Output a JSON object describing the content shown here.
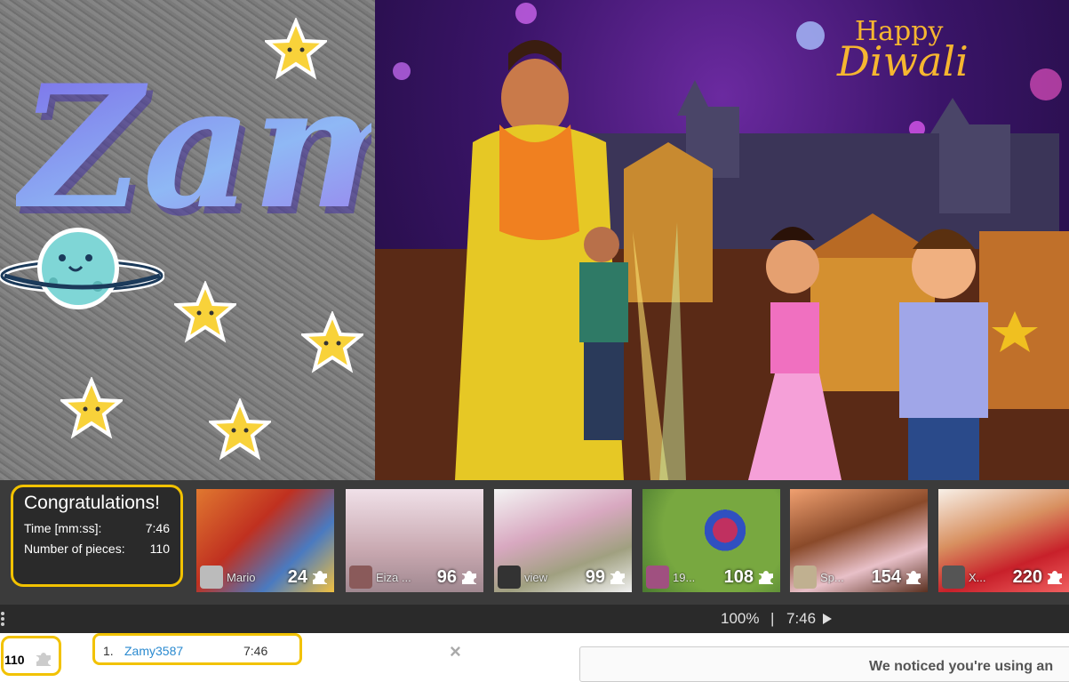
{
  "left_art": {
    "title_text": "Zamy"
  },
  "diwali": {
    "happy_text": "Happy",
    "diwali_text": "Diwali"
  },
  "congrats": {
    "title": "Congratulations!",
    "time_label": "Time [mm:ss]:",
    "time_value": "7:46",
    "pieces_label": "Number of pieces:",
    "pieces_value": "110"
  },
  "thumbnails": [
    {
      "user": "Mario",
      "count": "24",
      "theme": "mario"
    },
    {
      "user": "Eiza ...",
      "count": "96",
      "theme": "dancer"
    },
    {
      "user": "view",
      "count": "99",
      "theme": "magnolia"
    },
    {
      "user": "19...",
      "count": "108",
      "theme": "bird"
    },
    {
      "user": "Sp...",
      "count": "154",
      "theme": "spa"
    },
    {
      "user": "X...",
      "count": "220",
      "theme": "cookies"
    }
  ],
  "status_bar": {
    "zoom": "100%",
    "separator": "|",
    "time": "7:46"
  },
  "bottom": {
    "piece_count": "110",
    "leaderboard": {
      "rank": "1.",
      "user": "Zamy3587",
      "time": "7:46"
    },
    "close_symbol": "×",
    "adblock_notice": "We noticed you're using an"
  },
  "colors": {
    "highlight": "#f2c200",
    "link": "#2a8ad0",
    "bar_dark": "#2a2a2a"
  }
}
